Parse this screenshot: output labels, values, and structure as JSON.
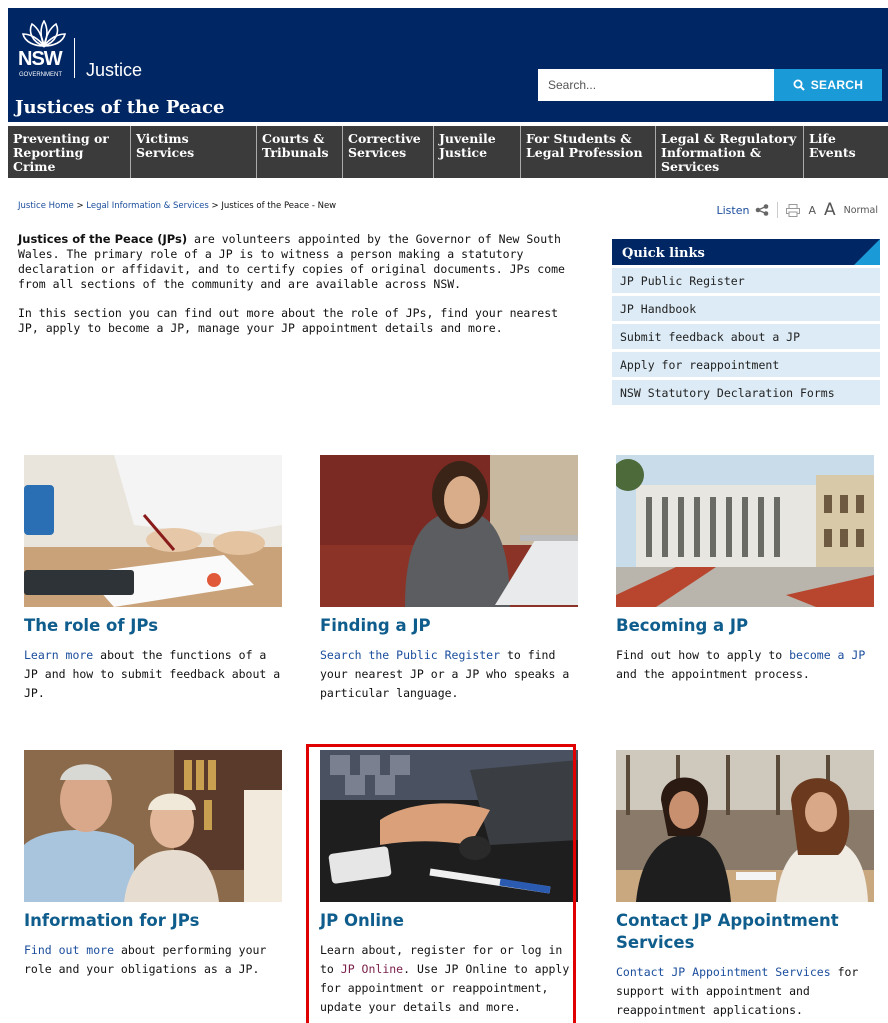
{
  "header": {
    "nsw_logo_text": "NSW",
    "government_text": "GOVERNMENT",
    "justice_text": "Justice",
    "site_title": "Justices of the Peace",
    "search_placeholder": "Search...",
    "search_button": "SEARCH"
  },
  "nav": {
    "items": [
      {
        "line1": "Preventing or",
        "line2": "Reporting Crime",
        "line3": ""
      },
      {
        "line1": "Victims Services",
        "line2": "",
        "line3": ""
      },
      {
        "line1": "Courts &",
        "line2": "Tribunals",
        "line3": ""
      },
      {
        "line1": "Corrective",
        "line2": "Services",
        "line3": ""
      },
      {
        "line1": "Juvenile",
        "line2": "Justice",
        "line3": ""
      },
      {
        "line1": "For Students &",
        "line2": "Legal Profession",
        "line3": ""
      },
      {
        "line1": "Legal & Regulatory",
        "line2": "Information &",
        "line3": "Services"
      },
      {
        "line1": "Life Events",
        "line2": "",
        "line3": ""
      }
    ]
  },
  "breadcrumb": {
    "home": "Justice Home",
    "sep": ">",
    "section": "Legal Information & Services",
    "current": "Justices of the Peace - New"
  },
  "tools": {
    "listen": "Listen",
    "a_small": "A",
    "a_big": "A",
    "normal": "Normal"
  },
  "intro": {
    "bold": "Justices of the Peace (JPs)",
    "p1_rest": " are volunteers appointed by the Governor of New South Wales. The primary role of a JP is to witness a person making a statutory declaration or affidavit, and to certify copies of original documents. JPs come from all sections of the community and are available across NSW.",
    "p2": "In this section you can find out more about the role of JPs, find your nearest JP, apply to become a JP, manage your JP appointment details and more."
  },
  "quicklinks": {
    "title": "Quick links",
    "items": [
      "JP Public Register",
      "JP Handbook",
      "Submit feedback about a JP",
      "Apply for reappointment",
      "NSW Statutory Declaration Forms"
    ]
  },
  "cards": [
    {
      "title": "The role of JPs",
      "link": "Learn more",
      "text": " about the functions of a JP and how to submit feedback about a JP."
    },
    {
      "title": "Finding a JP",
      "link": "Search the Public Register",
      "text": " to find your nearest JP or a JP who speaks a particular language."
    },
    {
      "title": "Becoming a JP",
      "pre": "Find out how to apply to ",
      "link": "become a JP",
      "text": " and the appointment process."
    },
    {
      "title": "Information for JPs",
      "link": "Find out more",
      "text": " about performing your role and your obligations as a JP."
    },
    {
      "title": "JP Online",
      "pre": "Learn about, register for or log in to ",
      "link": "JP Online",
      "text": ". Use JP Online to apply for appointment or reappointment, update your details and more."
    },
    {
      "title": "Contact JP Appointment Services",
      "link": "Contact JP Appointment Services",
      "text": " for support with appointment and reappointment applications."
    }
  ],
  "colors": {
    "header": "#002664",
    "nav": "#3b3b3b",
    "accent": "#1a9ad6",
    "highlight": "#e00000"
  }
}
